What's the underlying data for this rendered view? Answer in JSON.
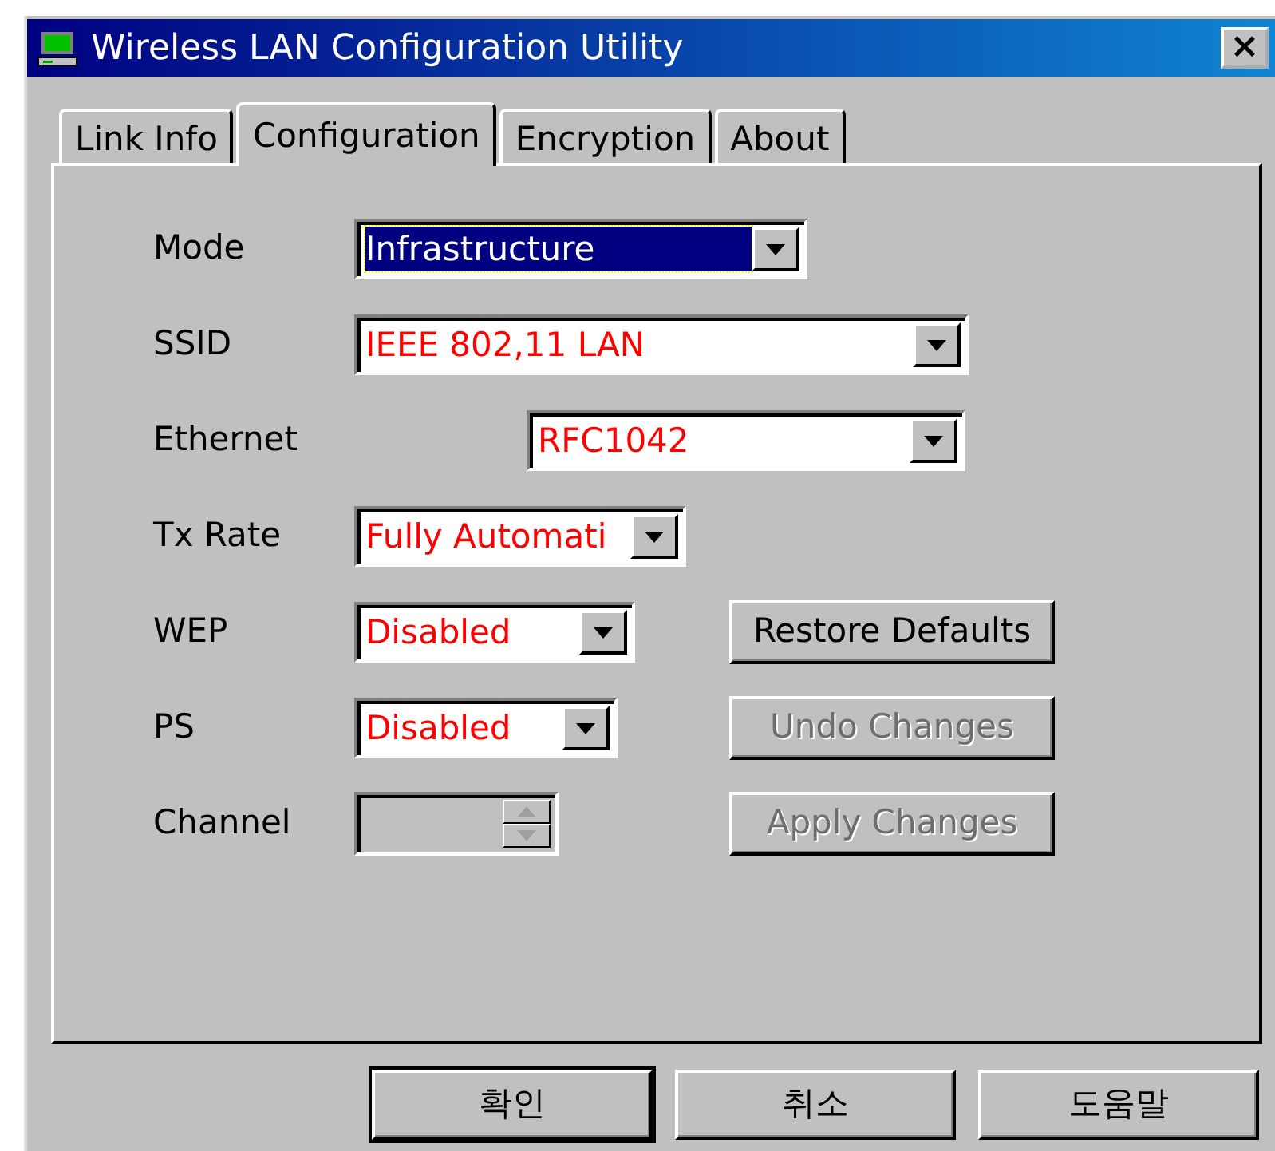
{
  "window": {
    "title": "Wireless LAN Configuration Utility",
    "close": "×"
  },
  "tabs": [
    {
      "label": "Link Info",
      "selected": false
    },
    {
      "label": "Configuration",
      "selected": true
    },
    {
      "label": "Encryption",
      "selected": false
    },
    {
      "label": "About",
      "selected": false
    }
  ],
  "fields": [
    {
      "kind": "combo",
      "label": "Mode",
      "value": "Infrastructure",
      "focused": true,
      "disabled": false
    },
    {
      "kind": "combo",
      "label": "SSID",
      "value": "IEEE 802,11 LAN",
      "focused": false,
      "disabled": false
    },
    {
      "kind": "combo",
      "label": "Ethernet",
      "value": "RFC1042",
      "focused": false,
      "disabled": false
    },
    {
      "kind": "combo",
      "label": "Tx Rate",
      "value": "Fully Automati",
      "focused": false,
      "disabled": false
    },
    {
      "kind": "combo",
      "label": "WEP",
      "value": "Disabled",
      "focused": false,
      "disabled": false
    },
    {
      "kind": "combo",
      "label": "PS",
      "value": "Disabled",
      "focused": false,
      "disabled": false
    },
    {
      "kind": "spin",
      "label": "Channel",
      "disabled": true
    }
  ],
  "actions": [
    {
      "label": "Restore Defaults",
      "disabled": false
    },
    {
      "label": "Undo Changes",
      "disabled": true
    },
    {
      "label": "Apply Changes",
      "disabled": true
    }
  ],
  "footer_buttons": [
    {
      "label": "확인",
      "default": true
    },
    {
      "label": "취소",
      "default": false
    },
    {
      "label": "도움말",
      "default": false
    }
  ]
}
